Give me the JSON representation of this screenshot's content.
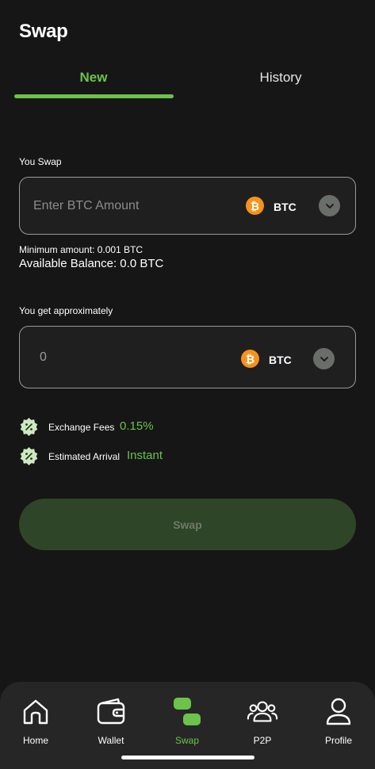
{
  "header": {
    "title": "Swap"
  },
  "tabs": [
    {
      "label": "New",
      "active": true
    },
    {
      "label": "History",
      "active": false
    }
  ],
  "swap_from": {
    "label": "You Swap",
    "placeholder": "Enter BTC Amount",
    "currency": "BTC",
    "coin_icon": "bitcoin-icon"
  },
  "minimum_amount": "Minimum amount: 0.001 BTC",
  "available_balance": "Available Balance: 0.0 BTC",
  "swap_to": {
    "label": "You get approximately",
    "value": "0",
    "currency": "BTC",
    "coin_icon": "bitcoin-icon"
  },
  "fees": {
    "exchange_label": "Exchange Fees",
    "exchange_value": "0.15%",
    "arrival_label": "Estimated Arrival",
    "arrival_value": "Instant"
  },
  "swap_button": {
    "label": "Swap"
  },
  "nav": {
    "items": [
      {
        "label": "Home",
        "icon": "home-icon"
      },
      {
        "label": "Wallet",
        "icon": "wallet-icon"
      },
      {
        "label": "Swap",
        "icon": "swap-icon",
        "active": true
      },
      {
        "label": "P2P",
        "icon": "people-icon"
      },
      {
        "label": "Profile",
        "icon": "user-icon"
      }
    ]
  },
  "colors": {
    "background": "#161616",
    "accent": "#6cc24a",
    "bitcoin": "#f5921b",
    "button_disabled": "#2f4527",
    "nav_bg": "#262626"
  }
}
